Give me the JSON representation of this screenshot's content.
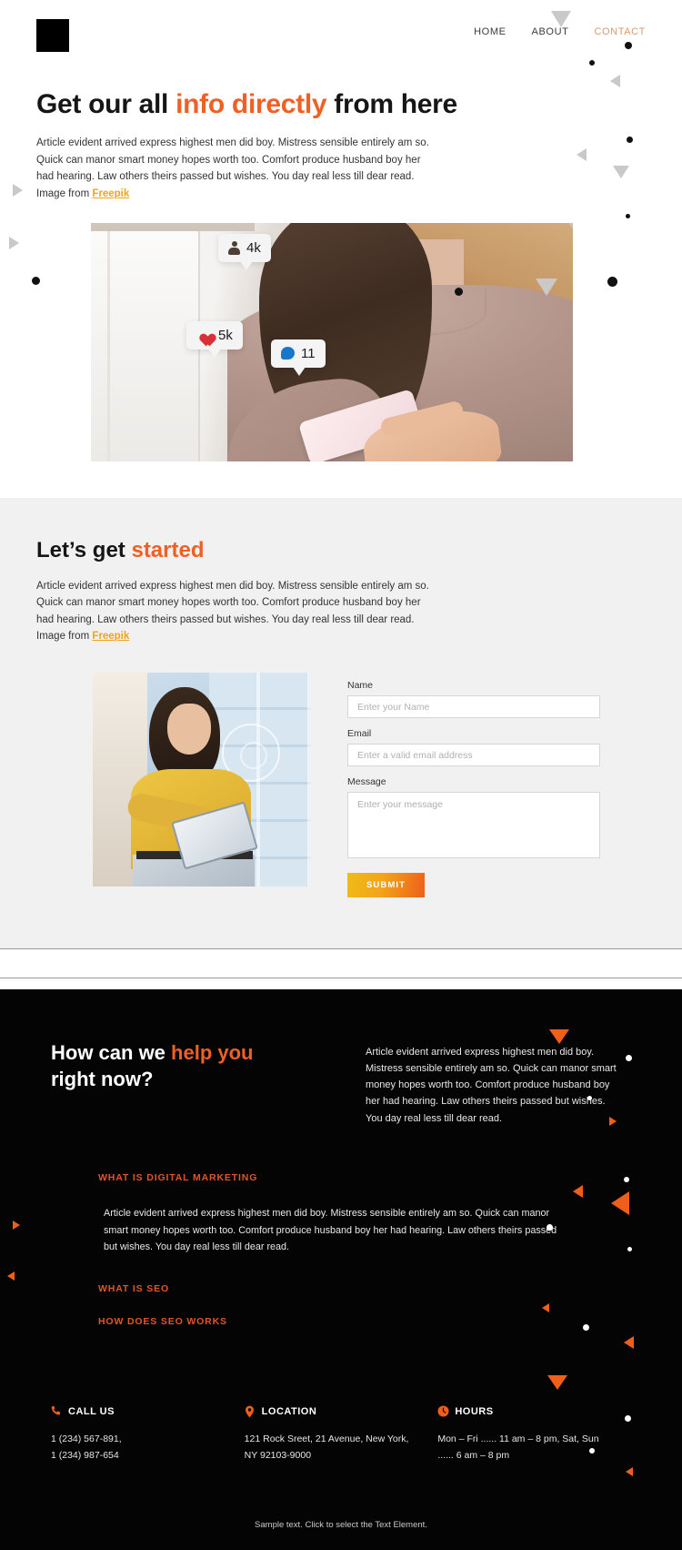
{
  "header": {
    "logo_name": "site-logo",
    "nav": [
      {
        "label": "HOME",
        "active": false
      },
      {
        "label": "ABOUT",
        "active": false
      },
      {
        "label": "CONTACT",
        "active": true
      }
    ]
  },
  "hero": {
    "title_part1": "Get our all ",
    "title_accent": "info directly",
    "title_part2": " from here",
    "paragraph": "Article evident arrived express highest men did boy. Mistress sensible entirely am so. Quick can manor smart money hopes worth too. Comfort produce husband boy her had hearing. Law others theirs passed but wishes. You day real less till dear read. Image from ",
    "link_label": "Freepik",
    "image_badges": [
      {
        "icon": "person-icon",
        "value": "4k"
      },
      {
        "icon": "heart-icon",
        "value": "5k"
      },
      {
        "icon": "comment-bubble-icon",
        "value": "11"
      }
    ]
  },
  "started": {
    "title_part1": "Let’s get ",
    "title_accent": "started",
    "paragraph": "Article evident arrived express highest men did boy. Mistress sensible entirely am so. Quick can manor smart money hopes worth too. Comfort produce husband boy her had hearing. Law others theirs passed but wishes. You day real less till dear read. Image from ",
    "link_label": "Freepik",
    "form": {
      "name_label": "Name",
      "name_placeholder": "Enter your Name",
      "email_label": "Email",
      "email_placeholder": "Enter a valid email address",
      "message_label": "Message",
      "message_placeholder": "Enter your message",
      "submit_label": "SUBMIT"
    }
  },
  "help": {
    "title_part1": "How can we ",
    "title_accent": "help you",
    "title_part2": "right now?",
    "paragraph": "Article evident arrived express highest men did boy. Mistress sensible entirely am so. Quick can manor smart money hopes worth too. Comfort produce husband boy her had hearing. Law others theirs passed but wishes. You day real less till dear read.",
    "accordion": [
      {
        "head": "WHAT IS DIGITAL MARKETING",
        "body": "Article evident arrived express highest men did boy. Mistress sensible entirely am so. Quick can manor smart money hopes worth too. Comfort produce husband boy her had hearing. Law others theirs passed but wishes. You day real less till dear read.",
        "open": true
      },
      {
        "head": "WHAT IS SEO",
        "body": "",
        "open": false
      },
      {
        "head": "HOW DOES SEO WORKS",
        "body": "",
        "open": false
      }
    ]
  },
  "footer": {
    "columns": [
      {
        "icon": "phone-icon",
        "head": "CALL US",
        "body": "1 (234) 567-891,\n1 (234) 987-654"
      },
      {
        "icon": "location-pin-icon",
        "head": "LOCATION",
        "body": "121 Rock Sreet, 21 Avenue, New York, NY 92103-9000"
      },
      {
        "icon": "clock-icon",
        "head": "HOURS",
        "body": "Mon – Fri  ......  11 am – 8 pm, Sat, Sun  ......  6 am – 8 pm"
      }
    ],
    "note": "Sample text. Click to select the Text Element."
  },
  "colors": {
    "accent_orange": "#ef6024",
    "accent_gold": "#efa41c",
    "nav_active": "#d99a6c",
    "dark_bg": "#040404",
    "light_section_bg": "#f1f1f1"
  }
}
